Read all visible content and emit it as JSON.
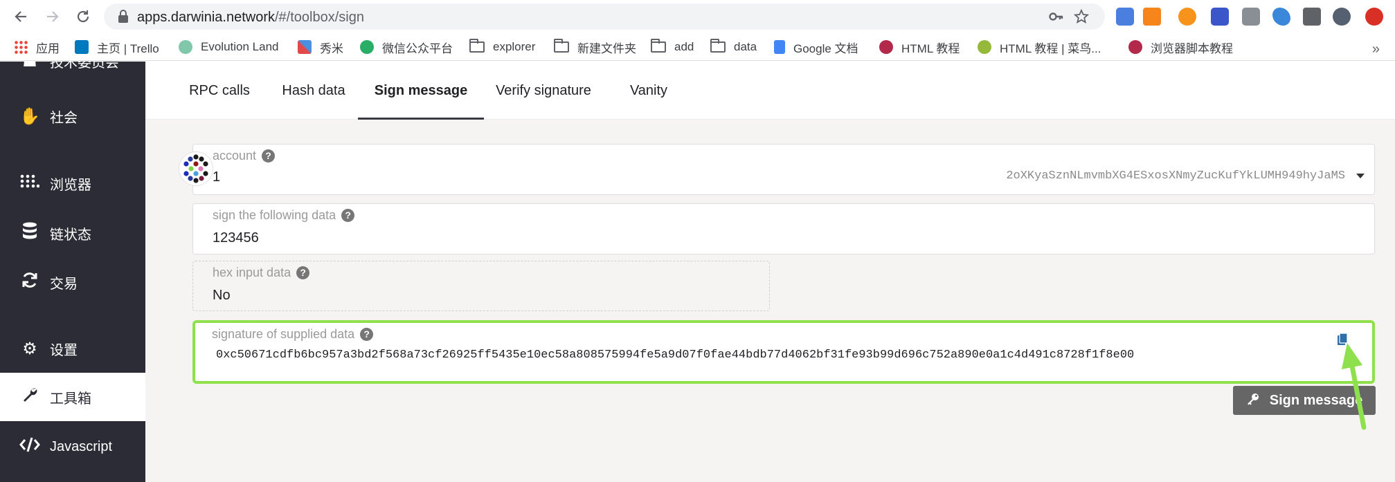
{
  "browser": {
    "url_host": "apps.darwinia.network",
    "url_path": "/#/toolbox/sign",
    "bookmarks": [
      {
        "label": "应用",
        "icon": "apps-grid-icon",
        "color": "#4285f4"
      },
      {
        "label": "主页 | Trello",
        "icon": "trello-icon",
        "color": "#0079bf"
      },
      {
        "label": "Evolution Land",
        "icon": "evolution-land-icon",
        "color": "#7fc8a9"
      },
      {
        "label": "秀米",
        "icon": "xiumi-icon",
        "color": "#e24a4a"
      },
      {
        "label": "微信公众平台",
        "icon": "wechat-icon",
        "color": "#2aae67"
      },
      {
        "label": "explorer",
        "icon": "folder-icon"
      },
      {
        "label": "新建文件夹",
        "icon": "folder-icon"
      },
      {
        "label": "add",
        "icon": "folder-icon"
      },
      {
        "label": "data",
        "icon": "folder-icon"
      },
      {
        "label": "Google 文档",
        "icon": "google-docs-icon",
        "color": "#4285f4"
      },
      {
        "label": "HTML 教程",
        "icon": "runoob-icon",
        "color": "#b3294b"
      },
      {
        "label": "HTML 教程 | 菜鸟...",
        "icon": "runoob-green-icon",
        "color": "#96b93b"
      },
      {
        "label": "浏览器脚本教程",
        "icon": "runoob-icon",
        "color": "#b3294b"
      }
    ],
    "more": "»"
  },
  "sidebar": {
    "items": [
      {
        "label": "技术委员会",
        "icon": "committee-icon"
      },
      {
        "label": "社会",
        "icon": "hand-icon"
      },
      {
        "label": "浏览器",
        "icon": "explorer-dots-icon"
      },
      {
        "label": "链状态",
        "icon": "database-icon"
      },
      {
        "label": "交易",
        "icon": "sync-icon"
      },
      {
        "label": "设置",
        "icon": "gears-icon"
      },
      {
        "label": "工具箱",
        "icon": "wrench-icon"
      },
      {
        "label": "Javascript",
        "icon": "code-icon"
      }
    ]
  },
  "tabs": [
    {
      "label": "RPC calls"
    },
    {
      "label": "Hash data"
    },
    {
      "label": "Sign message"
    },
    {
      "label": "Verify signature"
    },
    {
      "label": "Vanity"
    }
  ],
  "form": {
    "account": {
      "label": "account",
      "value": "1",
      "address": "2oXKyaSznNLmvmbXG4ESxosXNmyZucKufYkLUMH949hyJaMS"
    },
    "data": {
      "label": "sign the following data",
      "value": "123456"
    },
    "hex": {
      "label": "hex input data",
      "value": "No"
    },
    "signature": {
      "label": "signature of supplied data",
      "value": "0xc50671cdfb6bc957a3bd2f568a73cf26925ff5435e10ec58a808575994fe5a9d07f0fae44bdb77d4062bf31fe93b99d696c752a890e0a1c4d491c8728f1f8e00"
    },
    "help_glyph": "?"
  },
  "sign_button": {
    "label": "Sign message",
    "icon": "key-icon"
  },
  "colors": {
    "sidebar_bg": "#2c2c37",
    "highlight": "#8ee04c",
    "button_bg": "#666666",
    "copy_icon": "#2f6fa8"
  }
}
